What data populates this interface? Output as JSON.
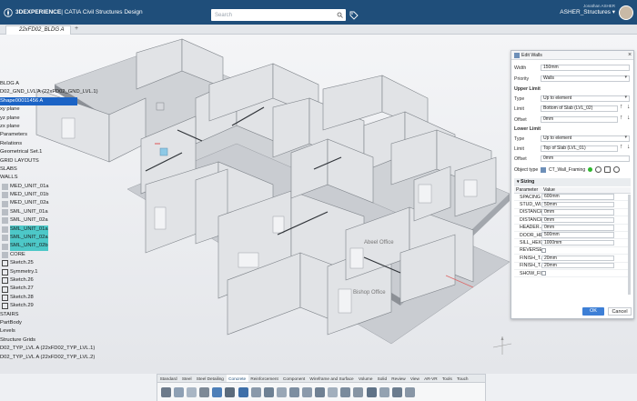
{
  "topbar": {
    "brand_prefix": "3D",
    "brand_main": "EXPERIENCE",
    "brand_app": " | CATIA Civil Structures Design",
    "search_placeholder": "Search",
    "user_name": "Jonathan ASHER",
    "structure": "ASHER_Structures ▾"
  },
  "tabs": [
    {
      "label": "22xFD02_BLDG A"
    }
  ],
  "tree": {
    "items": [
      {
        "label": "BLDG A",
        "state": "normal"
      },
      {
        "label": "D02_GND_LVL A (22xFD02_GND_LVL.1)",
        "state": "normal"
      },
      {
        "label": "Shape00011456 A",
        "state": "selected"
      },
      {
        "label": "xy plane",
        "state": "normal"
      },
      {
        "label": "yz plane",
        "state": "normal"
      },
      {
        "label": "zx plane",
        "state": "normal"
      },
      {
        "label": "Parameters",
        "state": "normal"
      },
      {
        "label": "Relations",
        "state": "normal"
      },
      {
        "label": "Geometrical Set.1",
        "state": "normal"
      },
      {
        "label": "GRID LAYOUTS",
        "state": "normal"
      },
      {
        "label": "SLABS",
        "state": "normal"
      },
      {
        "label": "WALLS",
        "state": "normal"
      },
      {
        "label": "MED_UNIT_01a",
        "state": "normal"
      },
      {
        "label": "MED_UNIT_01b",
        "state": "normal"
      },
      {
        "label": "MED_UNIT_02a",
        "state": "normal"
      },
      {
        "label": "SML_UNIT_01a",
        "state": "normal"
      },
      {
        "label": "SML_UNIT_02a",
        "state": "normal"
      },
      {
        "label": "SML_UNIT_01a",
        "state": "highlight"
      },
      {
        "label": "SML_UNIT_02a",
        "state": "highlight"
      },
      {
        "label": "SML_UNIT_02b",
        "state": "highlight"
      },
      {
        "label": "CORE",
        "state": "normal"
      },
      {
        "label": "Sketch.25",
        "state": "normal"
      },
      {
        "label": "Symmetry.1",
        "state": "normal"
      },
      {
        "label": "Sketch.26",
        "state": "normal"
      },
      {
        "label": "Sketch.27",
        "state": "normal"
      },
      {
        "label": "Sketch.28",
        "state": "normal"
      },
      {
        "label": "Sketch.29",
        "state": "normal"
      },
      {
        "label": "STAIRS",
        "state": "normal"
      },
      {
        "label": "PartBody",
        "state": "normal"
      },
      {
        "label": "Levels",
        "state": "normal"
      },
      {
        "label": "Structure Grids",
        "state": "normal"
      },
      {
        "label": "D02_TYP_LVL A (22xFD02_TYP_LVL.1)",
        "state": "normal"
      },
      {
        "label": "D02_TYP_LVL A (22xFD02_TYP_LVL.2)",
        "state": "normal"
      }
    ]
  },
  "scene_labels": {
    "room1": "Abeel Office",
    "room2": "Bishop Office"
  },
  "panel": {
    "title": "Edit Walls",
    "width_label": "Width",
    "width_value": "150mm",
    "priority_label": "Priority",
    "priority_value": "Walls",
    "upper_title": "Upper Limit",
    "upper_type_label": "Type",
    "upper_type_value": "Up to element",
    "upper_limit_label": "Limit",
    "upper_limit_value": "Bottom of Slab (LVL_02)",
    "upper_offset_label": "Offset",
    "upper_offset_value": "0mm",
    "lower_title": "Lower Limit",
    "lower_type_label": "Type",
    "lower_type_value": "Up to element",
    "lower_limit_label": "Limit",
    "lower_limit_value": "Top of Slab (LVL_01)",
    "lower_offset_label": "Offset",
    "lower_offset_value": "0mm",
    "objtype_label": "Object type",
    "objtype_value": "CT_Wall_Framing",
    "sizing_title": "Sizing",
    "col_param": "Parameter",
    "col_value": "Value",
    "rows": [
      {
        "name": "SPACING",
        "value": "600mm",
        "kind": "text"
      },
      {
        "name": "STUD_WI...",
        "value": "50mm",
        "kind": "text"
      },
      {
        "name": "DISTANCE...",
        "value": "0mm",
        "kind": "text"
      },
      {
        "name": "DISTANCE...",
        "value": "0mm",
        "kind": "text"
      },
      {
        "name": "HEADER...",
        "value": "0mm",
        "kind": "text"
      },
      {
        "name": "DOOR_HE...",
        "value": "500mm",
        "kind": "text"
      },
      {
        "name": "SILL_HEIG...",
        "value": "1000mm",
        "kind": "text"
      },
      {
        "name": "REVERSE...",
        "value": "",
        "kind": "check"
      },
      {
        "name": "FINISH_T...",
        "value": "20mm",
        "kind": "text"
      },
      {
        "name": "FINISH_T...",
        "value": "20mm",
        "kind": "text"
      },
      {
        "name": "SHOW_FI...",
        "value": "",
        "kind": "check"
      }
    ],
    "ok_label": "OK",
    "cancel_label": "Cancel"
  },
  "ribbon": {
    "tabs": [
      "Standard",
      "Steel",
      "Steel Detailing",
      "Concrete",
      "Reinforcement",
      "Component",
      "Wireframe and Surface",
      "Volume",
      "Solid",
      "Review",
      "View",
      "AR-VR",
      "Tools",
      "Touch"
    ],
    "active_tab": "Concrete"
  },
  "colors": {
    "topbar": "#1f4e7a",
    "selection": "#1b63c5",
    "highlight": "#4dc8c8",
    "ok": "#3d7fd6"
  }
}
